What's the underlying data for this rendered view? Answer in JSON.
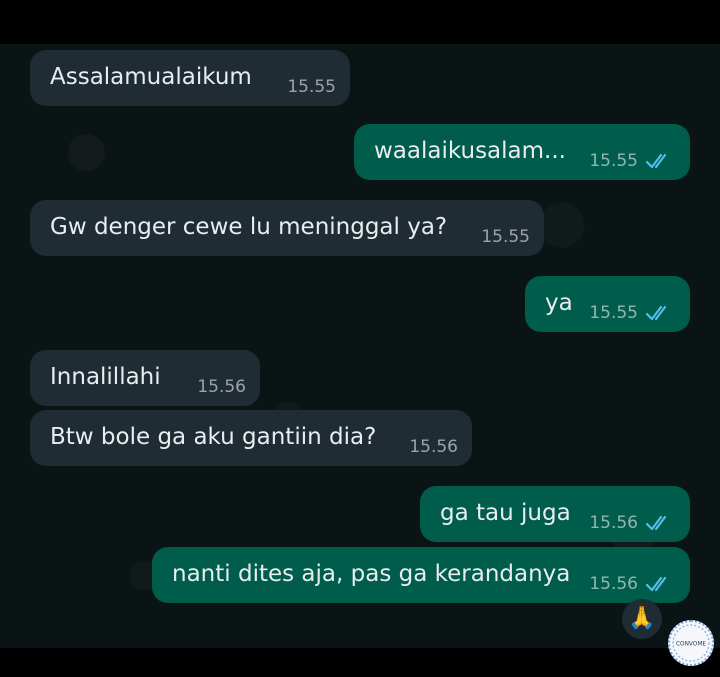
{
  "messages": [
    {
      "text": "Assalamualaikum",
      "time": "15.55",
      "direction": "incoming"
    },
    {
      "text": "waalaikusalam...",
      "time": "15.55",
      "direction": "outgoing",
      "read": true
    },
    {
      "text": "Gw denger cewe lu meninggal ya?",
      "time": "15.55",
      "direction": "incoming"
    },
    {
      "text": "ya",
      "time": "15.55",
      "direction": "outgoing",
      "read": true
    },
    {
      "text": "Innalillahi",
      "time": "15.56",
      "direction": "incoming"
    },
    {
      "text": "Btw bole ga aku gantiin dia?",
      "time": "15.56",
      "direction": "incoming"
    },
    {
      "text": "ga tau juga",
      "time": "15.56",
      "direction": "outgoing",
      "read": true
    },
    {
      "text": "nanti dites aja, pas ga kerandanya",
      "time": "15.56",
      "direction": "outgoing",
      "read": true
    }
  ],
  "reaction": {
    "emoji": "🙏"
  },
  "watermark": {
    "text": "CONVOME"
  },
  "colors": {
    "incoming_bubble": "#1f2c33",
    "outgoing_bubble": "#005c4b",
    "read_tick": "#53bdeb",
    "chat_background": "#0b1414"
  }
}
